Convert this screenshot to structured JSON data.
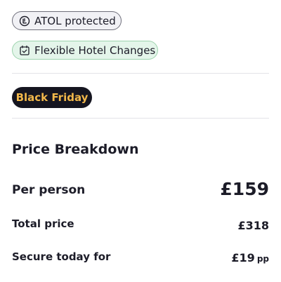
{
  "badges": {
    "atol": {
      "label": "ATOL protected",
      "icon": "atol-shield-icon"
    },
    "hotel_changes": {
      "label": "Flexible Hotel Changes",
      "icon": "calendar-check-icon"
    }
  },
  "promo": {
    "label": "Black Friday"
  },
  "price_breakdown": {
    "title": "Price Breakdown",
    "per_person": {
      "label": "Per person",
      "value": "£159"
    },
    "total": {
      "label": "Total price",
      "value": "£318"
    },
    "secure": {
      "label": "Secure today for",
      "value": "£19",
      "unit": "pp"
    }
  },
  "colors": {
    "promo_bg": "#151520",
    "promo_text": "#f2b84a",
    "hotel_pill_bg": "#e4f5ea",
    "hotel_pill_border": "#9dd3ad",
    "atol_pill_bg": "#f1f1f5"
  }
}
